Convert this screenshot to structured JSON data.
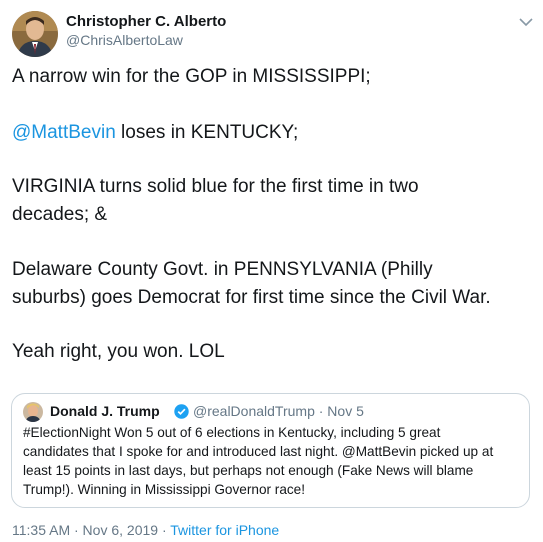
{
  "tweet": {
    "author_name": "Christopher C. Alberto",
    "author_handle": "@ChrisAlbertoLaw",
    "para1": "A narrow win for the GOP in MISSISSIPPI;",
    "para2_mention": "@MattBevin",
    "para2_rest": " loses in KENTUCKY;",
    "para3_line1": "VIRGINIA turns solid blue for the first time in two",
    "para3_line2": "decades; &",
    "para4_line1": "Delaware County Govt. in PENNSYLVANIA (Philly",
    "para4_line2": "suburbs) goes Democrat for first time since the Civil War.",
    "para5": "Yeah right, you won. LOL",
    "timestamp": "11:35 AM · Nov 6, 2019 ·",
    "source": "Twitter for iPhone"
  },
  "quoted": {
    "author_name": "Donald J. Trump",
    "author_handle": "@realDonaldTrump · Nov 5",
    "line1": "#ElectionNight  Won 5 out of 6 elections in Kentucky, including 5 great",
    "line2": "candidates that I spoke for and introduced last night. @MattBevin picked up at",
    "line3": "least 15 points in last days, but perhaps not enough (Fake News will blame",
    "line4": "Trump!). Winning in Mississippi Governor race!"
  },
  "icons": {
    "menu": "chevron-down-icon",
    "verified": "verified-badge-icon"
  },
  "colors": {
    "link": "#1b95e0",
    "muted": "#657786",
    "border": "#ccd6dd"
  }
}
